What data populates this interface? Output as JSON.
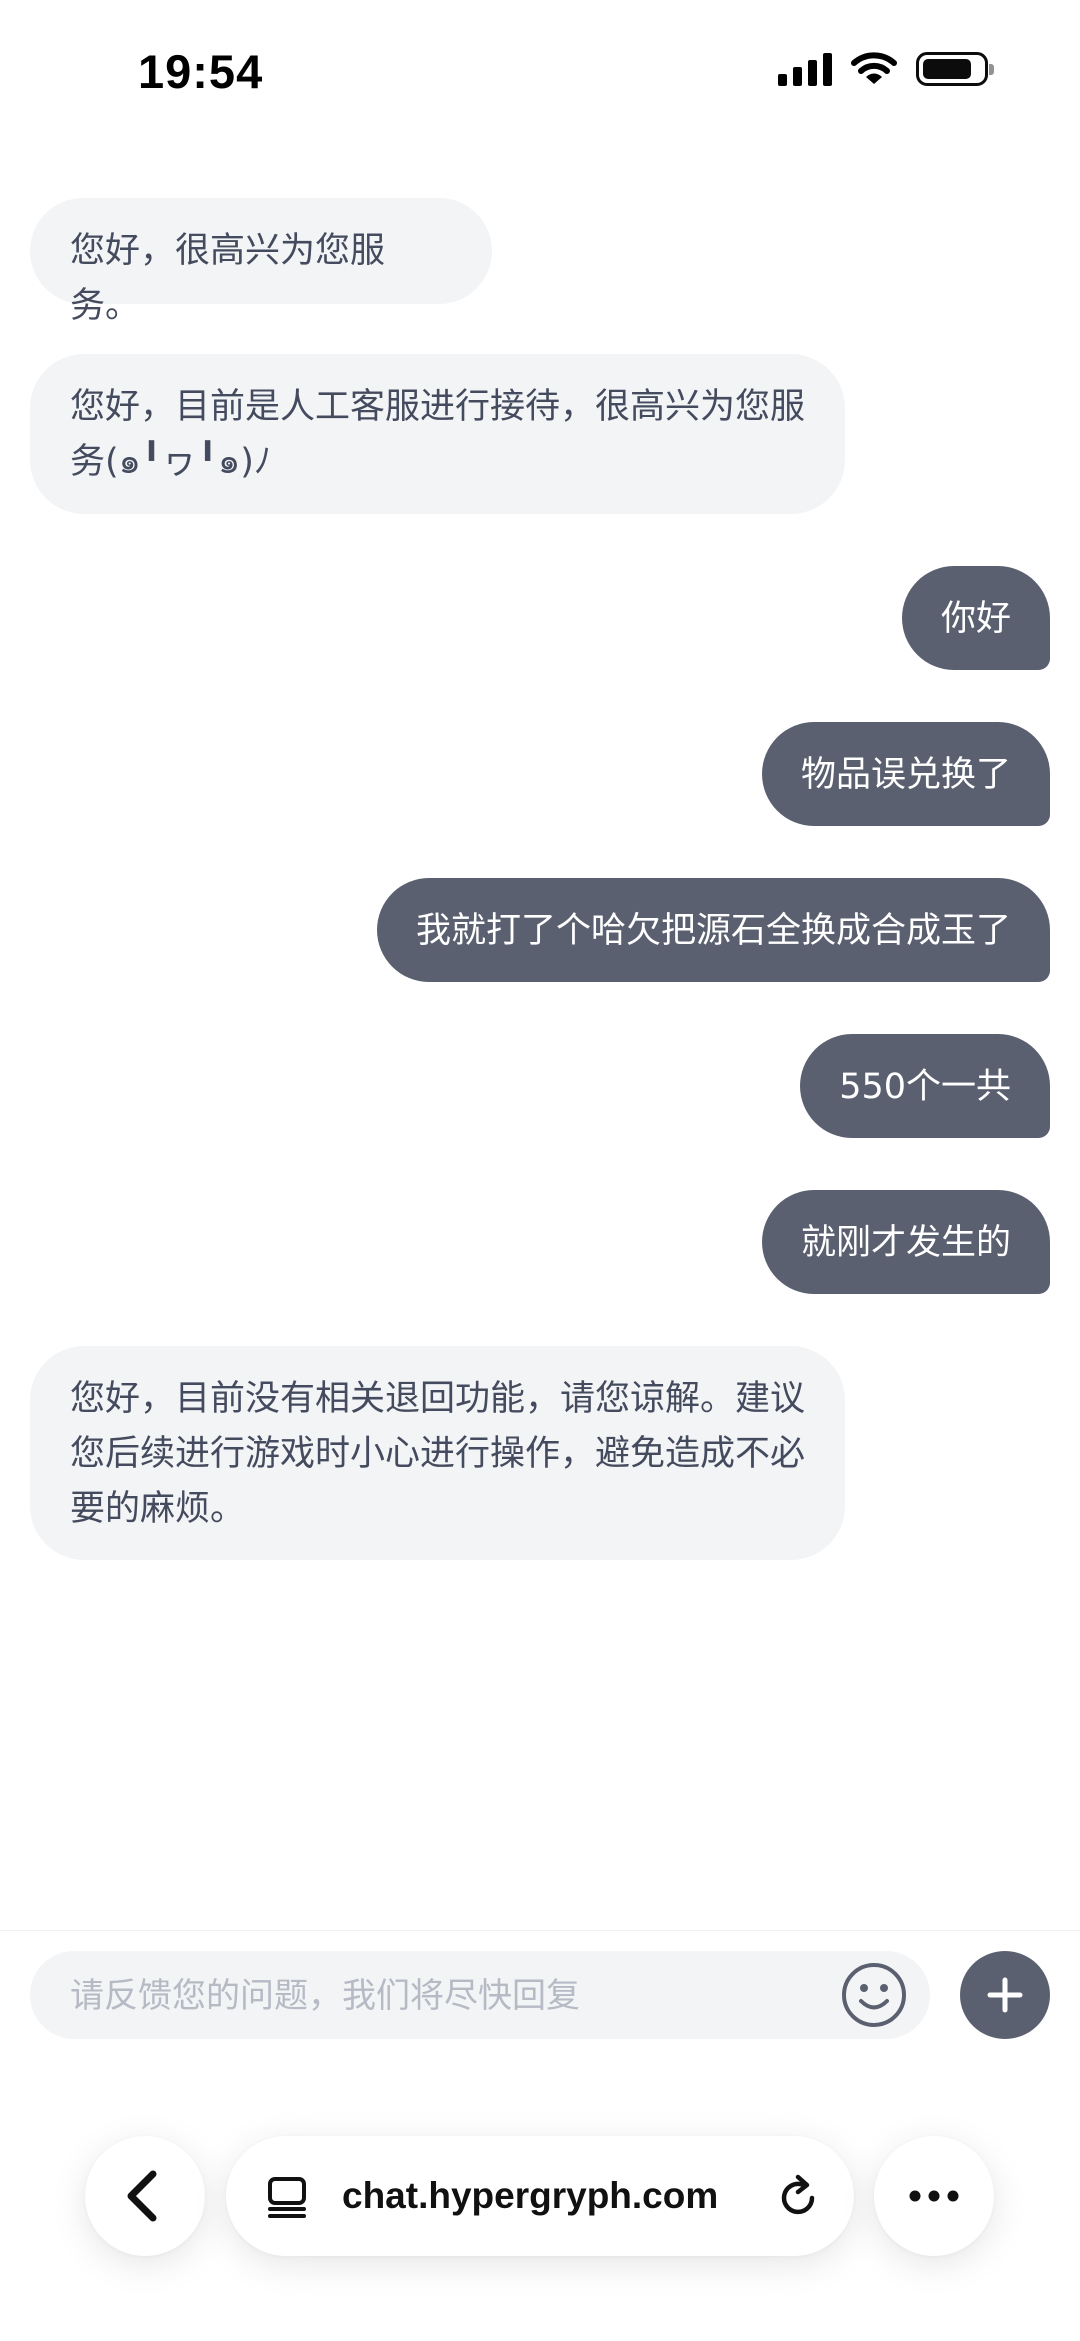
{
  "status_bar": {
    "time": "19:54",
    "icons": [
      "cellular-signal-icon",
      "wifi-icon",
      "battery-icon"
    ]
  },
  "messages": [
    {
      "sender": "agent",
      "text": "您好，很高兴为您服务。"
    },
    {
      "sender": "agent",
      "text": "您好，目前是人工客服进行接待，很高兴为您服务(๑╹ヮ╹๑)ﾉ"
    },
    {
      "sender": "user",
      "text": "你好"
    },
    {
      "sender": "user",
      "text": "物品误兑换了"
    },
    {
      "sender": "user",
      "text": "我就打了个哈欠把源石全换成合成玉了"
    },
    {
      "sender": "user",
      "text": "550个一共"
    },
    {
      "sender": "user",
      "text": "就刚才发生的"
    },
    {
      "sender": "agent",
      "text": "您好，目前没有相关退回功能，请您谅解。建议您后续进行游戏时小心进行操作，避免造成不必要的麻烦。"
    }
  ],
  "composer": {
    "placeholder": "请反馈您的问题，我们将尽快回复",
    "value": "",
    "emoji_icon": "smiley-icon",
    "add_icon": "plus-icon"
  },
  "browser_bar": {
    "url": "chat.hypergryph.com",
    "back_icon": "chevron-left-icon",
    "site_icon": "tabs-icon",
    "reload_icon": "reload-icon",
    "more_icon": "ellipsis-icon"
  },
  "colors": {
    "agent_bubble": "#f3f4f6",
    "user_bubble": "#5b6070",
    "text": "#454b5e",
    "placeholder": "#b6bac4"
  }
}
